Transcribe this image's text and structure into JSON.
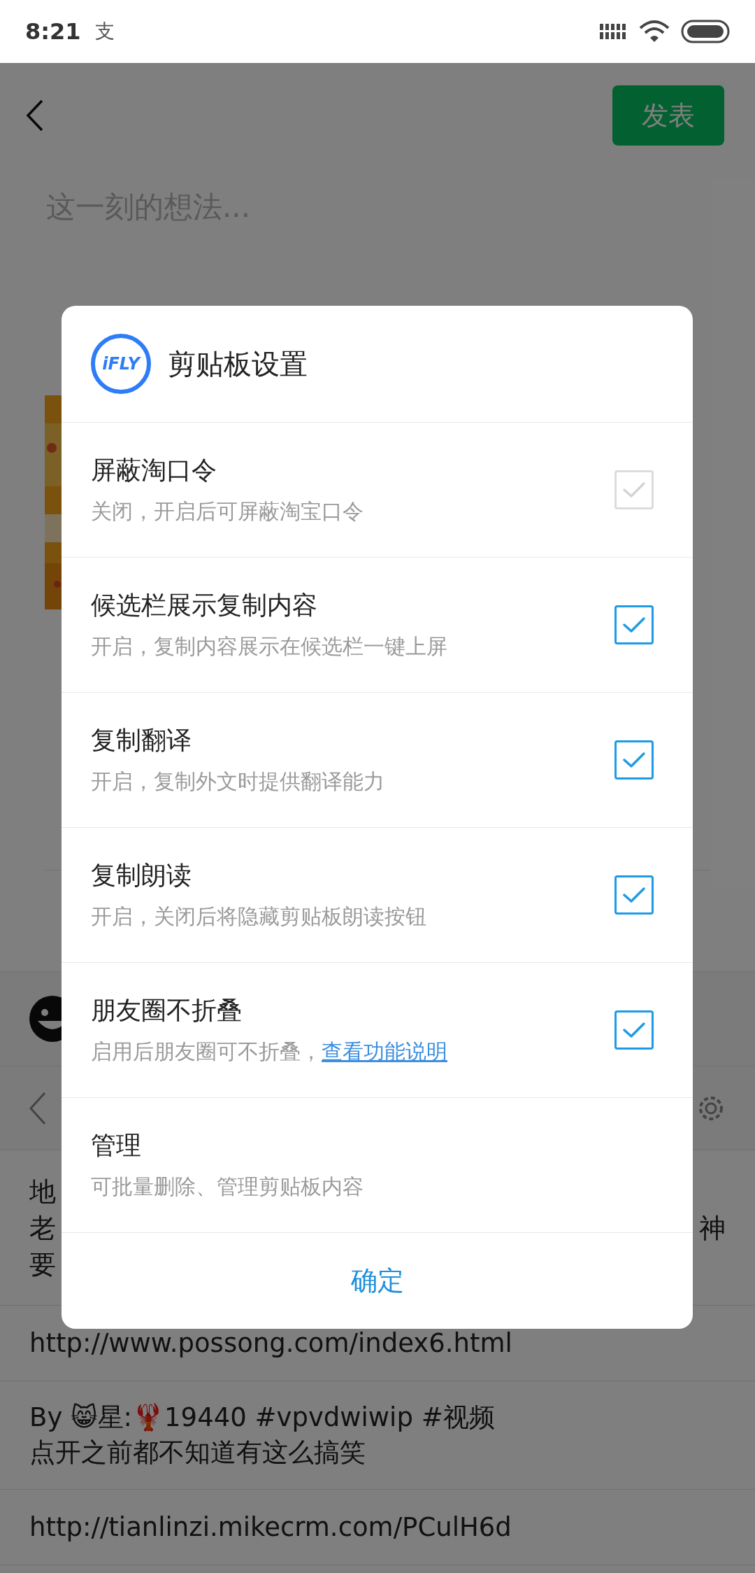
{
  "status_bar": {
    "time": "8:21",
    "notification_glyph": "支"
  },
  "top_bar": {
    "publish_button": "发表"
  },
  "composer": {
    "placeholder": "这一刻的想法..."
  },
  "clipboard_list": {
    "items": [
      {
        "kind": "covered",
        "left_lines": [
          "地",
          "老",
          "要"
        ],
        "right_text": "神"
      },
      {
        "kind": "text",
        "text": "http://www.possong.com/index6.html"
      },
      {
        "kind": "lines",
        "lines": [
          "By 😸星:🦞19440 #vpvdwiwip #视频",
          "点开之前都不知道有这么搞笑"
        ]
      },
      {
        "kind": "text",
        "text": "http://tianlinzi.mikecrm.com/PCulH6d"
      }
    ]
  },
  "dialog": {
    "logo_text": "iFLY",
    "title": "剪贴板设置",
    "options": [
      {
        "kind": "checkbox",
        "title": "屏蔽淘口令",
        "subtitle": "关闭，开启后可屏蔽淘宝口令",
        "checked": true,
        "disabled": true
      },
      {
        "kind": "checkbox",
        "title": "候选栏展示复制内容",
        "subtitle": "开启，复制内容展示在候选栏一键上屏",
        "checked": true,
        "disabled": false
      },
      {
        "kind": "checkbox",
        "title": "复制翻译",
        "subtitle": "开启，复制外文时提供翻译能力",
        "checked": true,
        "disabled": false
      },
      {
        "kind": "checkbox",
        "title": "复制朗读",
        "subtitle": "开启，关闭后将隐藏剪贴板朗读按钮",
        "checked": true,
        "disabled": false
      },
      {
        "kind": "checkbox",
        "title": "朋友圈不折叠",
        "subtitle": "启用后朋友圈可不折叠，",
        "link": "查看功能说明",
        "checked": true,
        "disabled": false
      },
      {
        "kind": "plain",
        "title": "管理",
        "subtitle": "可批量删除、管理剪贴板内容"
      }
    ],
    "confirm_button": "确定"
  }
}
